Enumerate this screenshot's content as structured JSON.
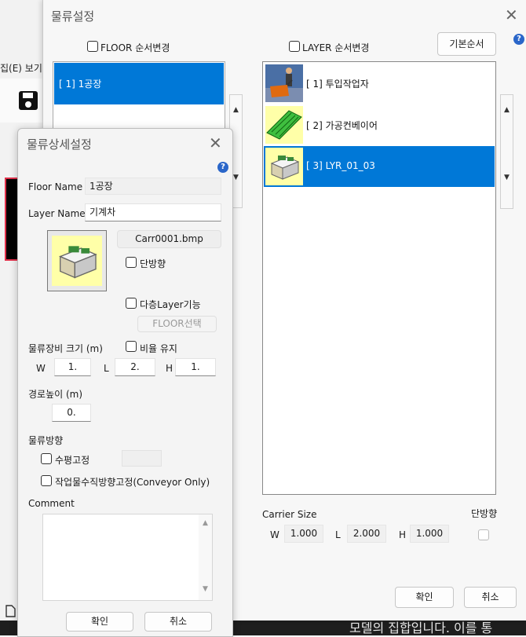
{
  "background_app": {
    "menu_text": "집(E)  보기",
    "bottom_text": "모델의 집합입니다. 이를 통"
  },
  "main_dialog": {
    "title": "물류설정",
    "floor_reorder_label": "FLOOR 순서변경",
    "layer_reorder_label": "LAYER 순서변경",
    "default_order_button": "기본순서",
    "floors": [
      {
        "label": "[ 1] 1공장",
        "selected": true
      }
    ],
    "layers": [
      {
        "label": "[ 1] 투입작업자",
        "icon": "worker-cart-icon",
        "selected": false
      },
      {
        "label": "[ 2] 가공컨베이어",
        "icon": "conveyor-icon",
        "selected": false
      },
      {
        "label": "[ 3] LYR_01_03",
        "icon": "machine-icon",
        "selected": true
      }
    ],
    "carrier_size_label": "Carrier Size",
    "carrier": {
      "w_label": "W",
      "w": "1.000",
      "l_label": "L",
      "l": "2.000",
      "h_label": "H",
      "h": "1.000"
    },
    "one_way_label": "단방향",
    "ok_button": "확인",
    "cancel_button": "취소"
  },
  "sub_dialog": {
    "title": "물류상세설정",
    "floor_name_label": "Floor Name",
    "floor_name_value": "1공장",
    "layer_name_label": "Layer Name",
    "layer_name_value": "기계차",
    "bitmap_file": "Carr0001.bmp",
    "one_way_label": "단방향",
    "multi_layer_label": "다층Layer기능",
    "floor_select_button": "FLOOR선택",
    "equip_size_label": "물류장비 크기 (m)",
    "keep_ratio_label": "비율 유지",
    "size": {
      "w_label": "W",
      "w": "1.",
      "l_label": "L",
      "l": "2.",
      "h_label": "H",
      "h": "1."
    },
    "route_height_label": "경로높이 (m)",
    "route_height_value": "0.",
    "direction_label": "물류방향",
    "horizontal_fix_label": "수평고정",
    "vertical_fix_label": "작업물수직방향고정(Conveyor Only)",
    "comment_label": "Comment",
    "comment_value": "",
    "ok_button": "확인",
    "cancel_button": "취소"
  },
  "colors": {
    "selection": "#0078d7",
    "thumb_bg": "#ffffa8",
    "help": "#2a66c9"
  }
}
